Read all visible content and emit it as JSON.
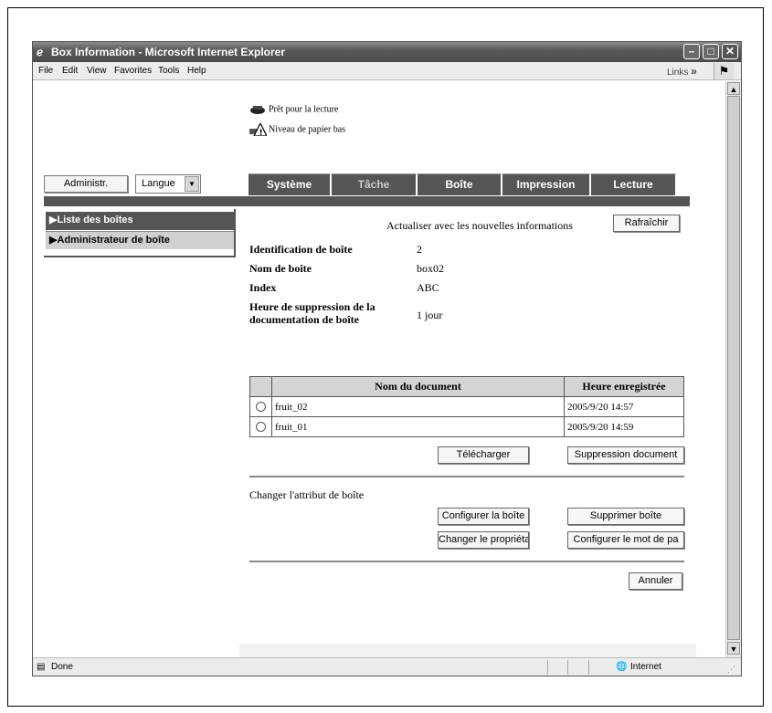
{
  "window": {
    "title": "Box Information - Microsoft Internet Explorer",
    "icon": "ie-icon"
  },
  "menubar": {
    "items": [
      "File",
      "Edit",
      "View",
      "Favorites",
      "Tools",
      "Help"
    ],
    "links_label": "Links",
    "links_chevron": "»"
  },
  "device_status": [
    {
      "icon": "printer-ready-icon",
      "text": "Prêt pour la lecture"
    },
    {
      "icon": "paper-low-warning-icon",
      "text": "Niveau de papier bas"
    }
  ],
  "top_controls": {
    "admin_label": "Administr.",
    "language_label": "Langue"
  },
  "tabs": [
    {
      "label": "Système",
      "active": true
    },
    {
      "label": "Tâche",
      "active": false
    },
    {
      "label": "Boîte",
      "active": true
    },
    {
      "label": "Impression",
      "active": true
    },
    {
      "label": "Lecture",
      "active": true
    }
  ],
  "sidebar": {
    "items": [
      {
        "label": "▶Liste des boîtes"
      },
      {
        "label": "▶Administrateur de boîte"
      }
    ]
  },
  "main": {
    "refresh_text": "Actualiser avec les nouvelles informations",
    "refresh_button": "Rafraîchir",
    "fields": [
      {
        "label": "Identification de boîte",
        "value": "2"
      },
      {
        "label": "Nom de boîte",
        "value": "box02"
      },
      {
        "label": "Index",
        "value": "ABC"
      },
      {
        "label": "Heure de suppression de la documentation de boîte",
        "value": "1 jour"
      }
    ],
    "table": {
      "headers": [
        "Nom du document",
        "Heure enregistrée"
      ],
      "rows": [
        {
          "name": "fruit_02",
          "time": "2005/9/20  14:57"
        },
        {
          "name": "fruit_01",
          "time": "2005/9/20  14:59"
        }
      ]
    },
    "download_button": "Télécharger",
    "delete_doc_button": "Suppression document",
    "change_attr_label": "Changer l'attribut de boîte",
    "configure_box_button": "Configurer la boîte",
    "delete_box_button": "Supprimer boîte",
    "change_owner_button": "Changer le propriétaire",
    "set_password_button": "Configurer le mot de pa",
    "cancel_button": "Annuler"
  },
  "statusbar": {
    "left": "Done",
    "zone": "Internet"
  }
}
